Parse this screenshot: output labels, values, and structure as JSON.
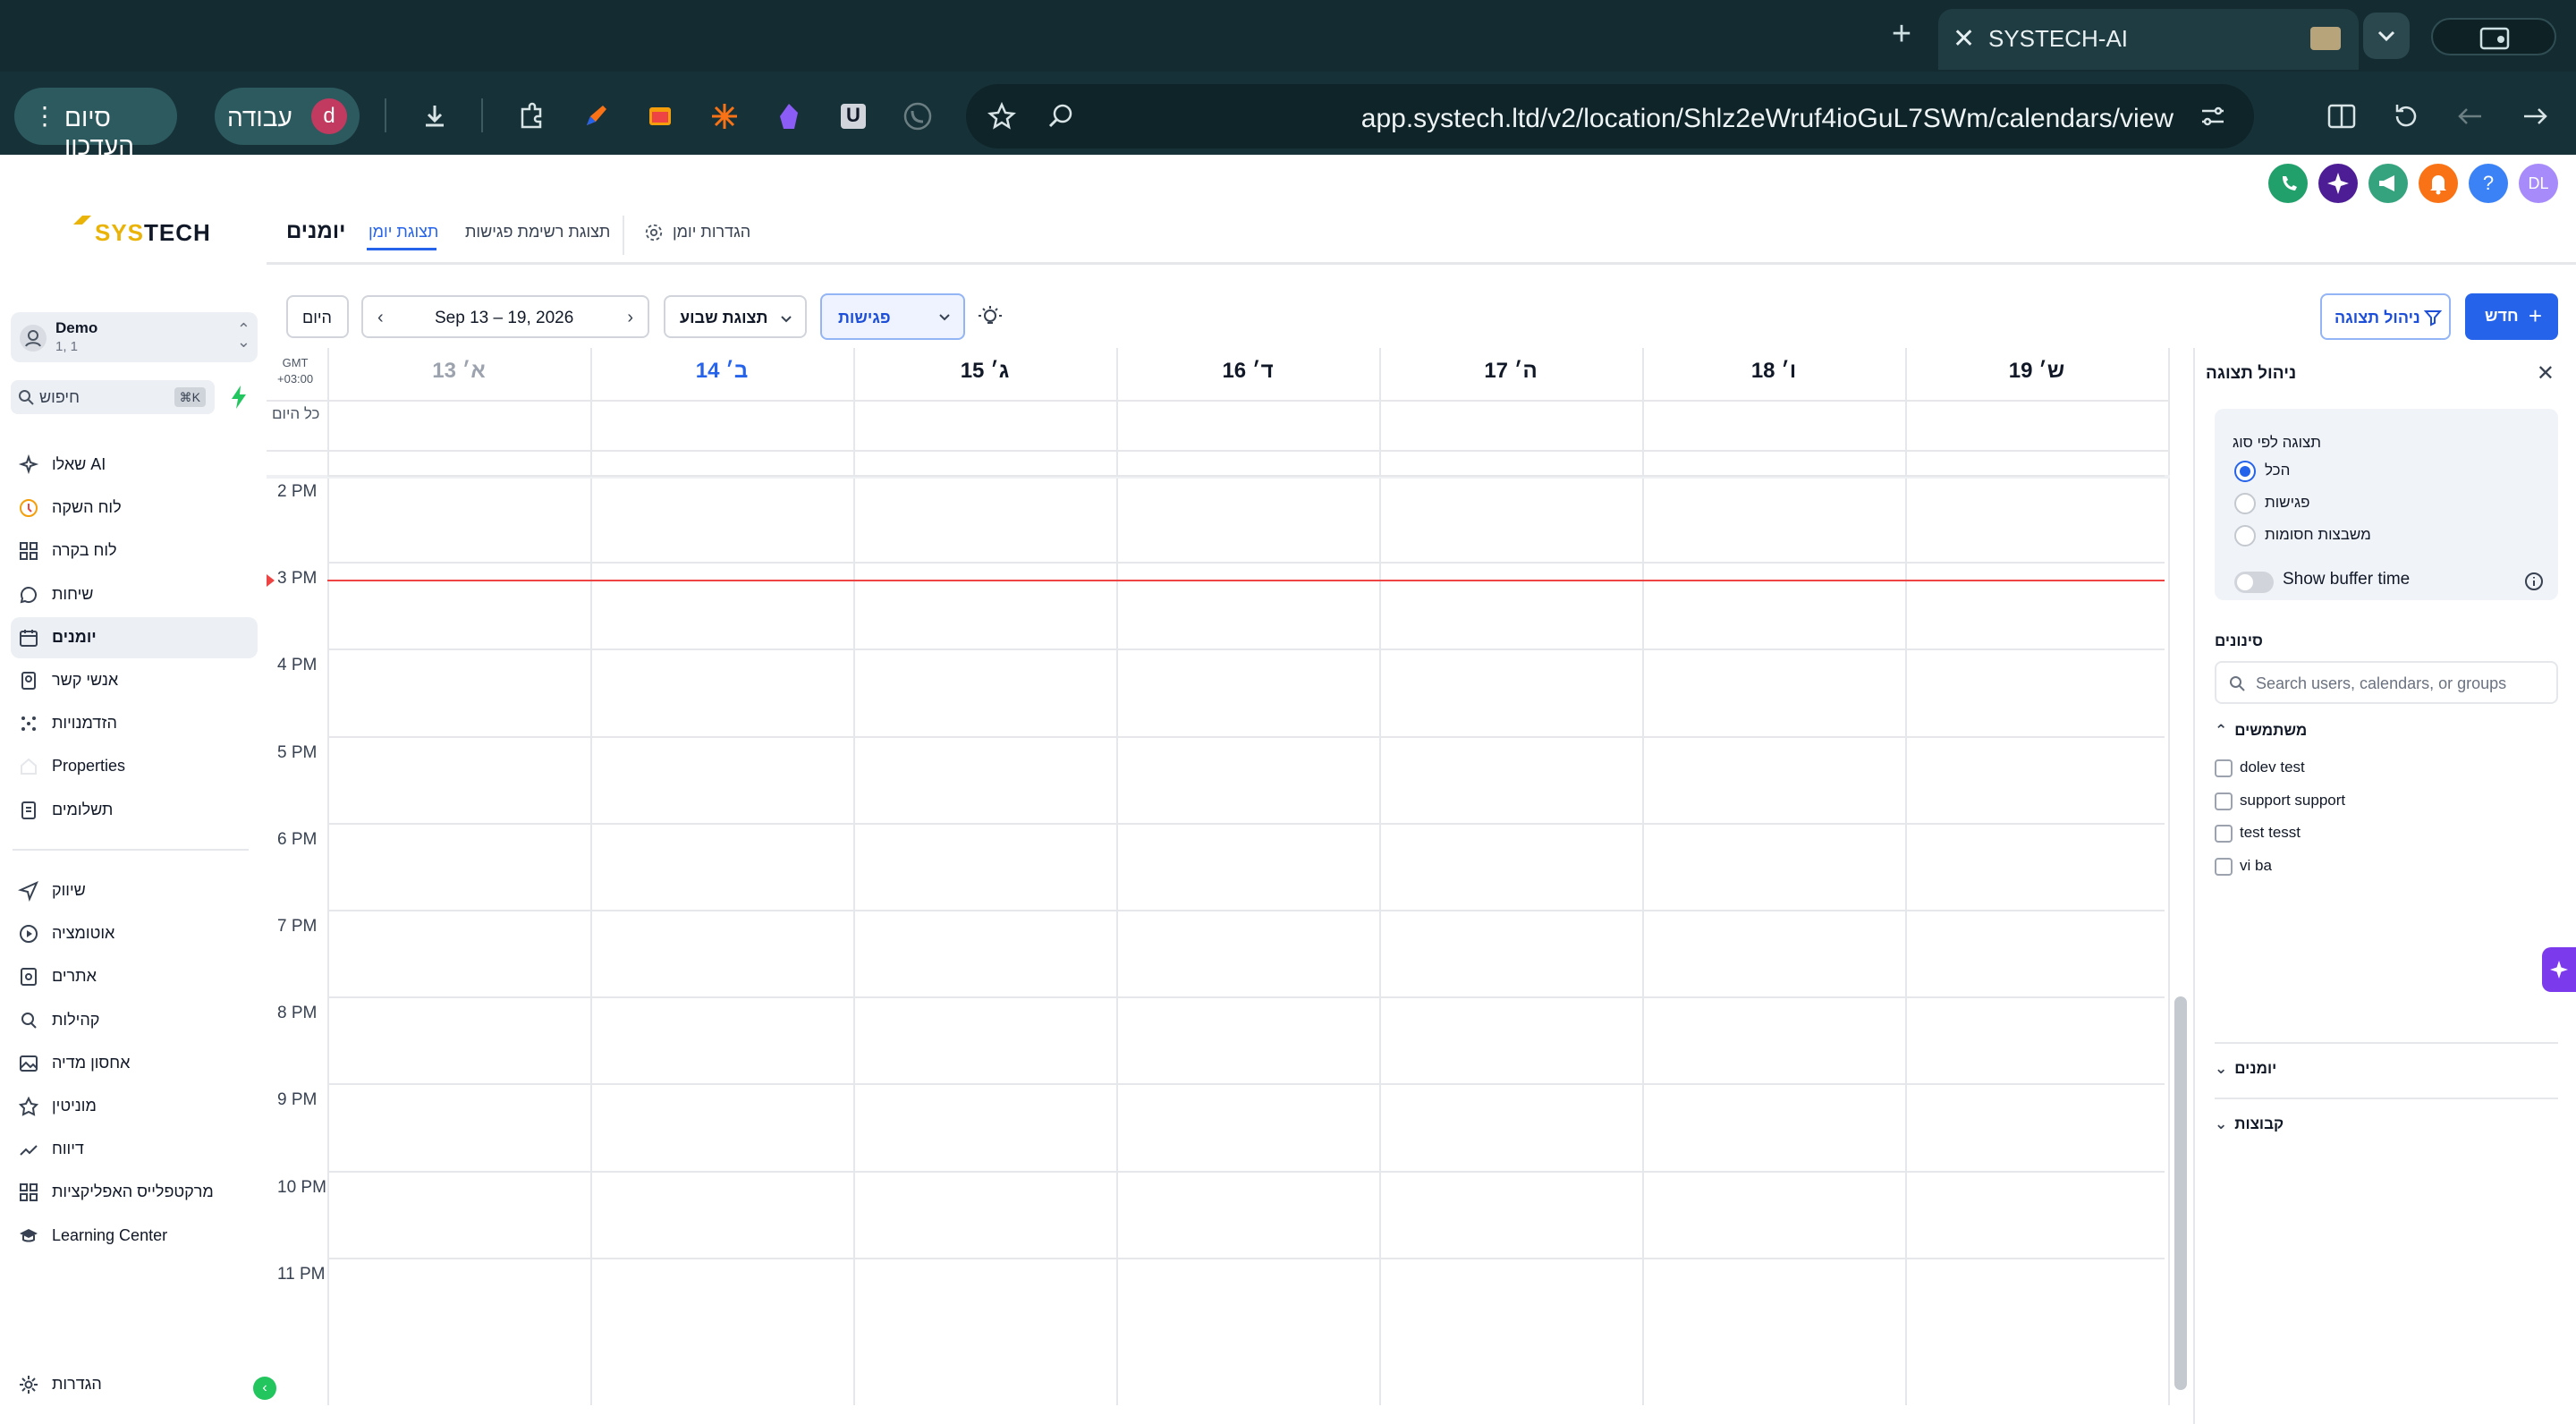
{
  "browser": {
    "tab_title": "SYSTECH-AI",
    "url": "app.systech.ltd/v2/location/Shlz2eWruf4ioGuL7SWm/calendars/view",
    "edit_pill_label": "סיום העדכון",
    "work_pill_label": "עבודה",
    "work_avatar": "d",
    "extension_u": "U"
  },
  "top_icons": {
    "help": "?",
    "user_initials": "DL"
  },
  "sidebar": {
    "logo_a": "SYS",
    "logo_b": "TECH",
    "account": {
      "name": "Demo",
      "sub": "1, 1"
    },
    "search": {
      "placeholder": "חיפוש",
      "shortcut": "⌘K"
    },
    "items": [
      {
        "label": "שאלו AI",
        "icon": "sparkle-icon"
      },
      {
        "label": "לוח השקה",
        "icon": "launch-icon"
      },
      {
        "label": "לוח בקרה",
        "icon": "dashboard-icon"
      },
      {
        "label": "שיחות",
        "icon": "chat-icon"
      },
      {
        "label": "יומנים",
        "icon": "calendar-icon",
        "active": true
      },
      {
        "label": "אנשי קשר",
        "icon": "contacts-icon"
      },
      {
        "label": "הזדמנויות",
        "icon": "opportunities-icon"
      },
      {
        "label": "Properties",
        "icon": "home-icon"
      },
      {
        "label": "תשלומים",
        "icon": "payments-icon"
      }
    ],
    "items2": [
      {
        "label": "שיווק",
        "icon": "send-icon"
      },
      {
        "label": "אוטומציה",
        "icon": "automation-icon"
      },
      {
        "label": "אתרים",
        "icon": "sites-icon"
      },
      {
        "label": "קהילות",
        "icon": "communities-icon"
      },
      {
        "label": "אחסון מדיה",
        "icon": "media-icon"
      },
      {
        "label": "מוניטין",
        "icon": "star-icon"
      },
      {
        "label": "דיווח",
        "icon": "report-icon"
      },
      {
        "label": "מרקטפלייס האפליקציות",
        "icon": "apps-icon"
      },
      {
        "label": "Learning Center",
        "icon": "graduation-icon"
      }
    ],
    "settings_label": "הגדרות"
  },
  "header": {
    "title": "יומנים",
    "tabs": [
      "תצוגת יומן",
      "תצוגת רשימת פגישות",
      "הגדרות יומן"
    ]
  },
  "controls": {
    "today": "היום",
    "date_range": "Sep 13 – 19, 2026",
    "view_select": "תצוגת שבוע",
    "type_select": "פגישות",
    "new": "חדש",
    "manage": "ניהול תצוגה"
  },
  "calendar": {
    "timezone": "GMT\n+03:00",
    "all_day": "כל היום",
    "days": [
      {
        "label": "13 א׳",
        "state": "past"
      },
      {
        "label": "14 ב׳",
        "state": "today"
      },
      {
        "label": "15 ג׳",
        "state": ""
      },
      {
        "label": "16 ד׳",
        "state": ""
      },
      {
        "label": "17 ה׳",
        "state": ""
      },
      {
        "label": "18 ו׳",
        "state": ""
      },
      {
        "label": "19 ש׳",
        "state": ""
      }
    ],
    "hours": [
      "2 PM",
      "3 PM",
      "4 PM",
      "5 PM",
      "6 PM",
      "7 PM",
      "8 PM",
      "9 PM",
      "10 PM",
      "11 PM"
    ],
    "now_color": "#ef4444"
  },
  "panel": {
    "title": "ניהול תצוגה",
    "type_label": "תצוגה לפי סוג",
    "options": [
      "הכל",
      "פגישות",
      "משבצות חסומות"
    ],
    "selected_option": 0,
    "buffer_label": "Show buffer time",
    "filters_label": "סינונים",
    "search_placeholder": "Search users, calendars, or groups",
    "users_group": "משתמשים",
    "users": [
      "dolev test",
      "support support",
      "test tesst",
      "vi ba"
    ],
    "calendars_group": "יומנים",
    "groups_group": "קבוצות"
  },
  "colors": {
    "accent": "#2563eb",
    "chrome": "#163137",
    "now_line": "#ef4444"
  }
}
